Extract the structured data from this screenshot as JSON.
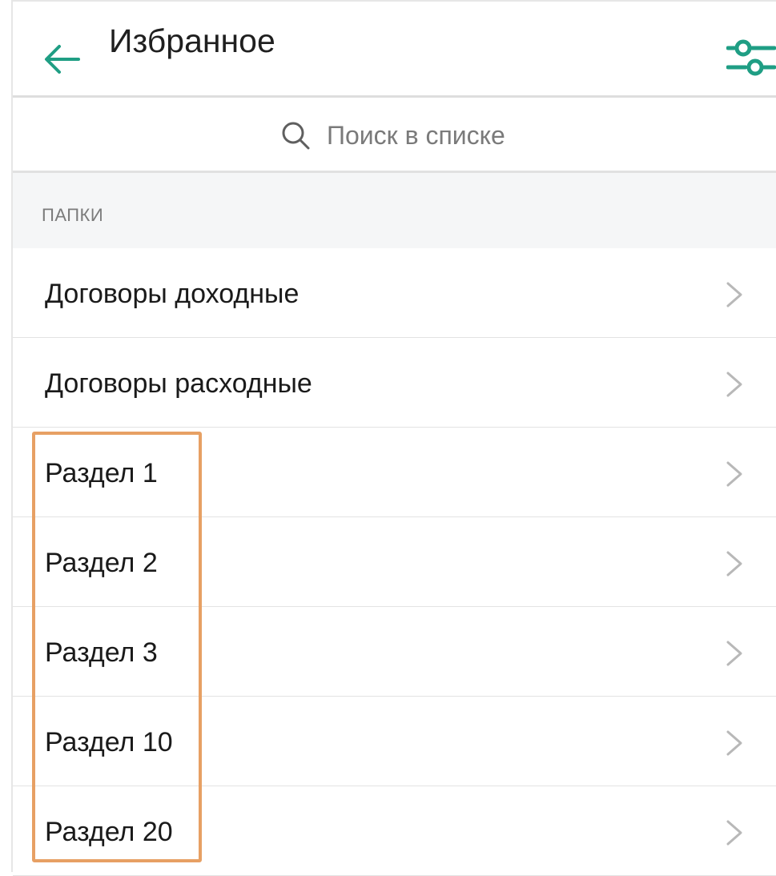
{
  "header": {
    "title": "Избранное",
    "back_icon": "arrow-left-icon",
    "filter_icon": "sliders-icon",
    "accent_color": "#1f9e84"
  },
  "search": {
    "placeholder": "Поиск в списке",
    "icon": "search-icon"
  },
  "folders": {
    "section_label": "ПАПКИ",
    "items": [
      {
        "label": "Договоры доходные"
      },
      {
        "label": "Договоры расходные"
      },
      {
        "label": "Раздел 1"
      },
      {
        "label": "Раздел 2"
      },
      {
        "label": "Раздел 3"
      },
      {
        "label": "Раздел 10"
      },
      {
        "label": "Раздел 20"
      }
    ],
    "chevron_icon": "chevron-right-icon"
  },
  "annotation": {
    "highlight_color": "#e7a064"
  }
}
